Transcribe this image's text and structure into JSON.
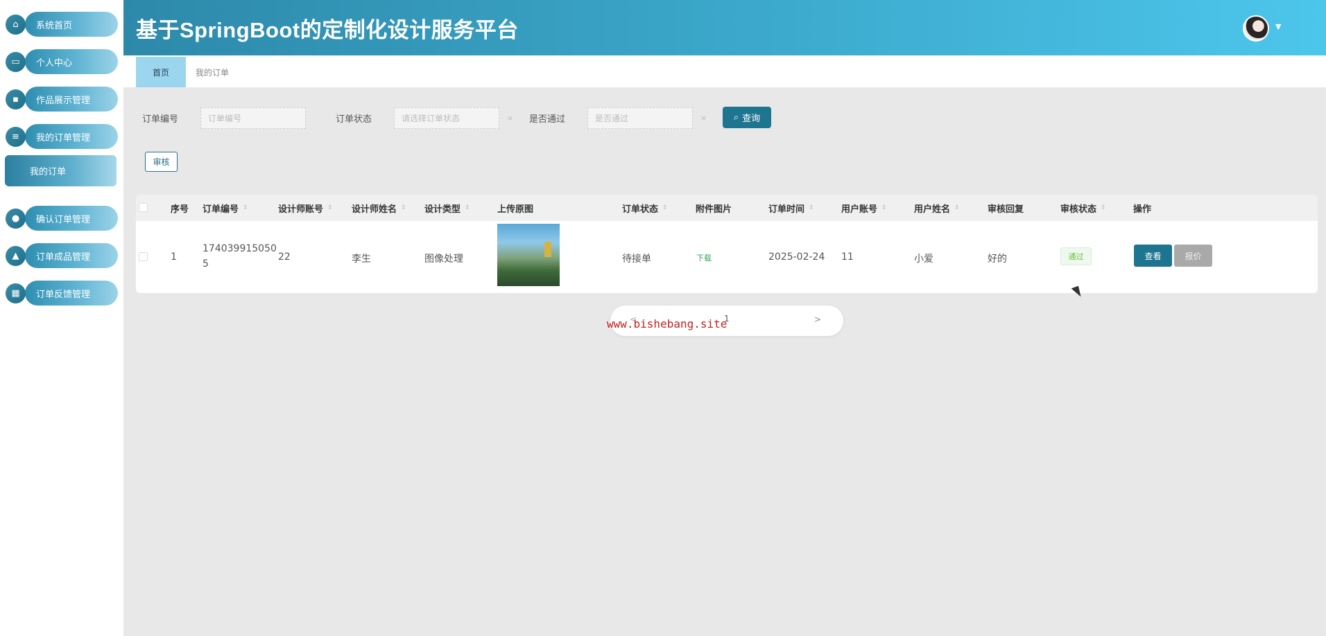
{
  "app": {
    "title": "基于SpringBoot的定制化设计服务平台"
  },
  "sidebar": {
    "items": [
      {
        "label": "系统首页",
        "icon": "home-icon"
      },
      {
        "label": "个人中心",
        "icon": "profile-card-icon"
      },
      {
        "label": "作品展示管理",
        "icon": "monitor-icon"
      },
      {
        "label": "我的订单管理",
        "icon": "sliders-icon"
      },
      {
        "label": "确认订单管理",
        "icon": "location-icon"
      },
      {
        "label": "订单成品管理",
        "icon": "stamp-icon"
      },
      {
        "label": "订单反馈管理",
        "icon": "grid-icon"
      }
    ],
    "submenu": {
      "label": "我的订单"
    }
  },
  "tabs": [
    {
      "label": "首页",
      "active": true
    },
    {
      "label": "我的订单",
      "active": false
    }
  ],
  "search": {
    "order_no_label": "订单编号",
    "order_no_placeholder": "订单编号",
    "order_status_label": "订单状态",
    "order_status_placeholder": "请选择订单状态",
    "passed_label": "是否通过",
    "passed_placeholder": "是否通过",
    "query_label": "查询",
    "audit_label": "审核"
  },
  "table": {
    "headers": [
      "序号",
      "订单编号",
      "设计师账号",
      "设计师姓名",
      "设计类型",
      "上传原图",
      "订单状态",
      "附件图片",
      "订单时间",
      "用户账号",
      "用户姓名",
      "审核回复",
      "审核状态",
      "操作"
    ],
    "rows": [
      {
        "index": "1",
        "order_no_line1": "174039915050",
        "order_no_line2": "5",
        "designer_account": "22",
        "designer_name": "李生",
        "design_type": "图像处理",
        "order_status": "待接单",
        "attachment": "下载",
        "order_time": "2025-02-24",
        "user_account": "11",
        "user_name": "小爱",
        "audit_reply": "好的",
        "audit_status": "通过",
        "view_label": "查看",
        "quote_label": "报价"
      }
    ]
  },
  "pagination": {
    "prev": "<",
    "page": "1",
    "next": ">"
  },
  "watermark": "www.bishebang.site",
  "colors": {
    "primary": "#1d7590",
    "header_start": "#2d89aa",
    "header_end": "#4dc6ec",
    "pass": "#67c23a"
  }
}
